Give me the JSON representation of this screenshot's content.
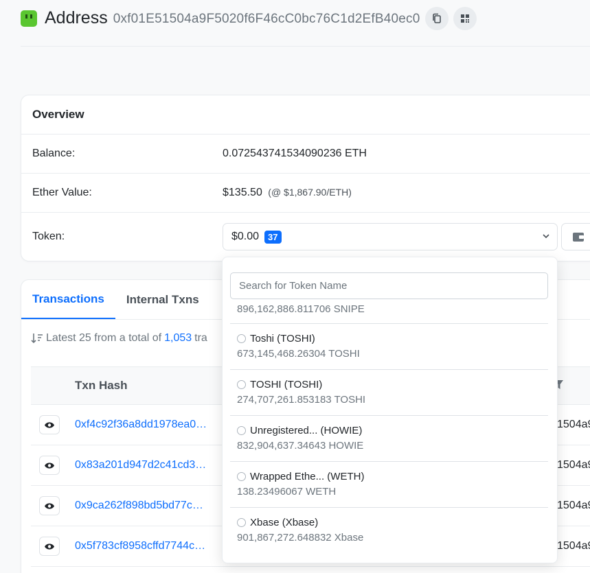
{
  "header": {
    "title": "Address",
    "address": "0xf01E51504a9F5020f6F46cC0bc76C1d2EfB40ec0",
    "copy_icon": "copy-icon",
    "qr_icon": "qr-code-icon"
  },
  "overview": {
    "title": "Overview",
    "balance_label": "Balance:",
    "balance_value": "0.072543741534090236 ETH",
    "ether_label": "Ether Value:",
    "ether_value": "$135.50",
    "ether_rate": "(@ $1,867.90/ETH)",
    "token_label": "Token:",
    "token_value": "$0.00",
    "token_count": "37"
  },
  "transactions": {
    "tabs": [
      {
        "label": "Transactions",
        "active": true
      },
      {
        "label": "Internal Txns",
        "active": false
      }
    ],
    "info_prefix": "Latest 25 from a total of",
    "info_count": "1,053",
    "info_suffix": "tra",
    "column_txhash": "Txn Hash",
    "rows": [
      {
        "hash": "0xf4c92f36a8dd1978ea0…",
        "tail": "1504a9"
      },
      {
        "hash": "0x83a201d947d2c41cd3…",
        "tail": "1504a9"
      },
      {
        "hash": "0x9ca262f898bd5bd77c…",
        "tail": "1504a9"
      },
      {
        "hash": "0x5f783cf8958cffd7744c…",
        "tail": "1504a9"
      }
    ]
  },
  "token_dropdown": {
    "search_placeholder": "Search for Token Name",
    "cut_item": "896,162,886.811706 SNIPE",
    "items": [
      {
        "name": "Toshi (TOSHI)",
        "amount": "673,145,468.26304 TOSHI"
      },
      {
        "name": "TOSHI (TOSHI)",
        "amount": "274,707,261.853183 TOSHI"
      },
      {
        "name": "Unregistered... (HOWIE)",
        "amount": "832,904,637.34643 HOWIE"
      },
      {
        "name": "Wrapped Ethe... (WETH)",
        "amount": "138.23496067 WETH"
      },
      {
        "name": "Xbase (Xbase)",
        "amount": "901,867,272.648832 Xbase"
      }
    ]
  },
  "colors": {
    "accent": "#0d6efd",
    "avatar": "#5ac630"
  }
}
